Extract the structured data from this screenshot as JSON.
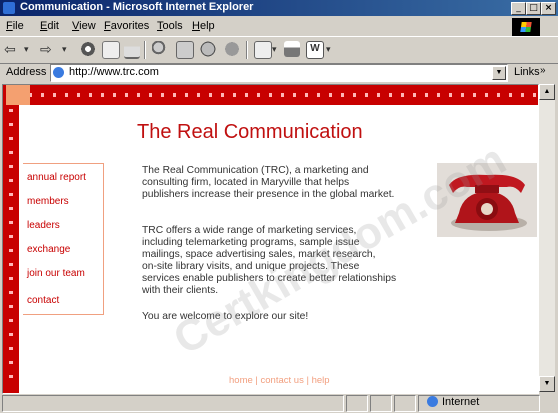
{
  "window": {
    "title": "Communication - Microsoft Internet Explorer",
    "minimize_glyph": "_",
    "maximize_glyph": "□",
    "close_glyph": "×"
  },
  "menu": {
    "items": [
      {
        "key": "F",
        "rest": "ile"
      },
      {
        "key": "E",
        "rest": "dit"
      },
      {
        "key": "V",
        "rest": "iew"
      },
      {
        "key": "F",
        "rest": "avorites"
      },
      {
        "key": "T",
        "rest": "ools"
      },
      {
        "key": "H",
        "rest": "elp"
      }
    ]
  },
  "toolbar": {
    "back_glyph": "⇦",
    "forward_glyph": "⇨",
    "dropdown_glyph": "▾",
    "icons": [
      "stop-icon",
      "refresh-icon",
      "home-icon",
      "search-icon",
      "favorites-icon",
      "history-icon",
      "mail-icon",
      "print-icon",
      "edit-icon"
    ]
  },
  "address": {
    "label": "Address",
    "url": "http://www.trc.com",
    "dropdown_glyph": "▼",
    "links_label": "Links",
    "links_glyph": "»"
  },
  "page": {
    "title": "The Real Communication",
    "nav": [
      "annual report",
      "members",
      "leaders",
      "exchange",
      "join our team",
      "contact"
    ],
    "paragraph1_lines": [
      "The Real Communication (TRC), a marketing and",
      "consulting firm, located in Maryville that helps",
      "publishers increase their presence in the global market."
    ],
    "paragraph2_lines": [
      "TRC offers a wide range of marketing services,",
      "including telemarketing programs, sample issue",
      "mailings, space advertising sales, market research,",
      "on-site library visits, and unique projects. These",
      "services enable publishers to create better relationships",
      "with their clients."
    ],
    "welcome": "You are welcome to explore our site!",
    "footer": {
      "home": "home",
      "sep1": " | ",
      "contact": "contact us",
      "sep2": " | ",
      "help": "help"
    },
    "watermark": "Certkingdom.com"
  },
  "scrollbar": {
    "up_glyph": "▲",
    "down_glyph": "▼"
  },
  "status": {
    "zone": "Internet"
  },
  "colors": {
    "accent_red": "#c80000",
    "title_red": "#c01010",
    "footer_orange": "#f2a080",
    "chrome": "#d4d0c8"
  }
}
